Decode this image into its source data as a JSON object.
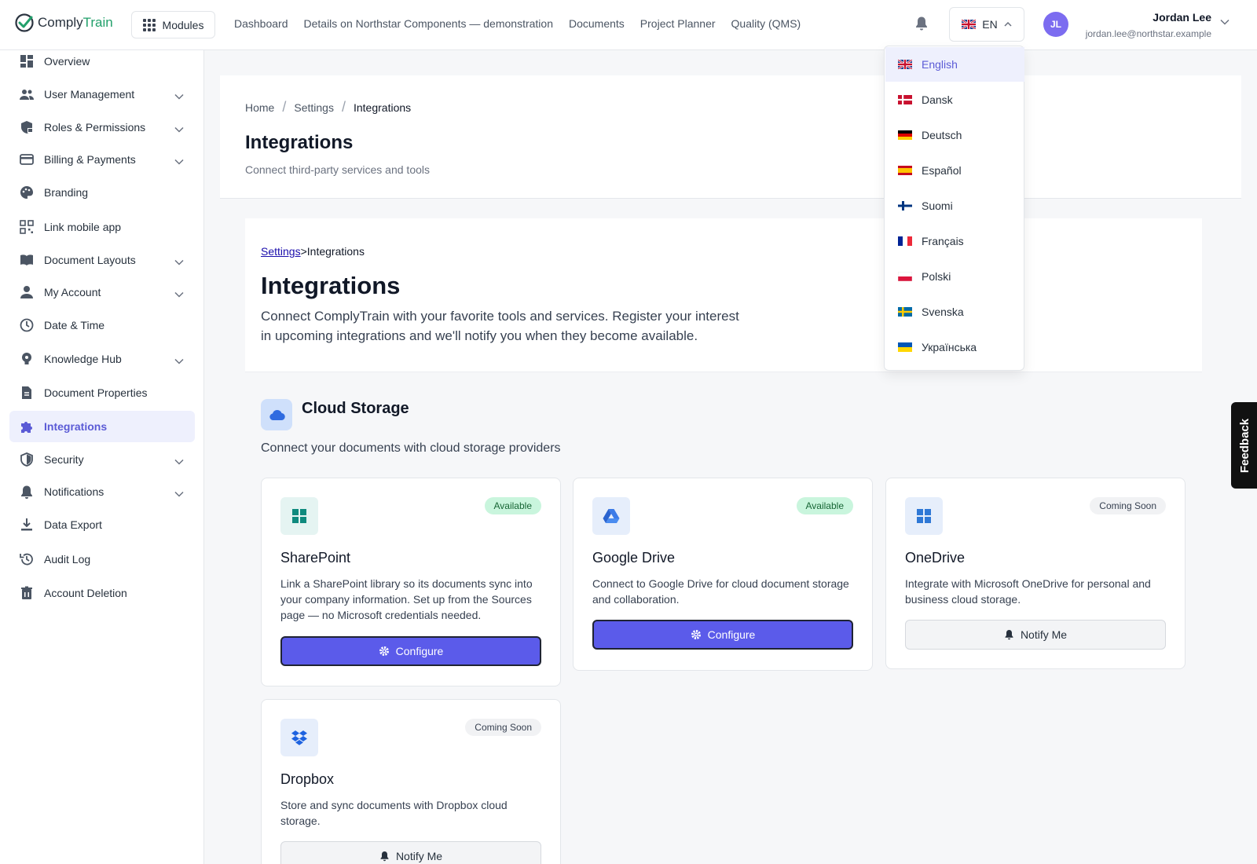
{
  "brand": {
    "name_part1": "Comply",
    "name_part2": "Train"
  },
  "topbar": {
    "modules_label": "Modules",
    "nav": [
      "Dashboard",
      "Details on Northstar Components — demonstration",
      "Documents",
      "Project Planner",
      "Quality (QMS)"
    ],
    "language_code": "EN",
    "user": {
      "initials": "JL",
      "name": "Jordan Lee",
      "email": "jordan.lee@northstar.example"
    }
  },
  "sidebar": {
    "items": [
      {
        "label": "Overview",
        "icon": "dashboard-icon",
        "expandable": false
      },
      {
        "label": "User Management",
        "icon": "users-icon",
        "expandable": true
      },
      {
        "label": "Roles & Permissions",
        "icon": "shield-lock-icon",
        "expandable": true
      },
      {
        "label": "Billing & Payments",
        "icon": "credit-card-icon",
        "expandable": true
      },
      {
        "label": "Branding",
        "icon": "palette-icon",
        "expandable": false
      },
      {
        "label": "Link mobile app",
        "icon": "qr-code-icon",
        "expandable": false
      },
      {
        "label": "Document Layouts",
        "icon": "book-icon",
        "expandable": true
      },
      {
        "label": "My Account",
        "icon": "person-icon",
        "expandable": true
      },
      {
        "label": "Date & Time",
        "icon": "clock-icon",
        "expandable": false
      },
      {
        "label": "Knowledge Hub",
        "icon": "lightbulb-icon",
        "expandable": true
      },
      {
        "label": "Document Properties",
        "icon": "document-icon",
        "expandable": false
      },
      {
        "label": "Integrations",
        "icon": "puzzle-icon",
        "expandable": false,
        "active": true
      },
      {
        "label": "Security",
        "icon": "shield-icon",
        "expandable": true
      },
      {
        "label": "Notifications",
        "icon": "bell-icon",
        "expandable": true
      },
      {
        "label": "Data Export",
        "icon": "download-icon",
        "expandable": false
      },
      {
        "label": "Audit Log",
        "icon": "history-icon",
        "expandable": false
      },
      {
        "label": "Account Deletion",
        "icon": "trash-icon",
        "expandable": false
      }
    ]
  },
  "header": {
    "breadcrumb": [
      "Home",
      "Settings",
      "Integrations"
    ],
    "title": "Integrations",
    "subtitle": "Connect third-party services and tools"
  },
  "content": {
    "crumb_link": "Settings",
    "crumb_sep": ">",
    "crumb_current": "Integrations",
    "title": "Integrations",
    "description": "Connect ComplyTrain with your favorite tools and services. Register your interest in upcoming integrations and we'll notify you when they become available."
  },
  "cloud_storage": {
    "title": "Cloud Storage",
    "subtitle": "Connect your documents with cloud storage providers",
    "cards": [
      {
        "name": "SharePoint",
        "badge": "Available",
        "description": "Link a SharePoint library so its documents sync into your company information. Set up from the Sources page — no Microsoft credentials needed.",
        "button": "Configure"
      },
      {
        "name": "Google Drive",
        "badge": "Available",
        "description": "Connect to Google Drive for cloud document storage and collaboration.",
        "button": "Configure"
      },
      {
        "name": "OneDrive",
        "badge": "Coming Soon",
        "description": "Integrate with Microsoft OneDrive for personal and business cloud storage.",
        "button": "Notify Me"
      },
      {
        "name": "Dropbox",
        "badge": "Coming Soon",
        "description": "Store and sync documents with Dropbox cloud storage.",
        "button": "Notify Me"
      }
    ]
  },
  "language_menu": {
    "selected": "English",
    "options": [
      "English",
      "Dansk",
      "Deutsch",
      "Español",
      "Suomi",
      "Français",
      "Polski",
      "Svenska",
      "Українська"
    ]
  },
  "feedback_label": "Feedback",
  "colors": {
    "accent": "#5b5bea",
    "brand_green": "#22a06b",
    "available_badge": "#c9f5dd"
  }
}
